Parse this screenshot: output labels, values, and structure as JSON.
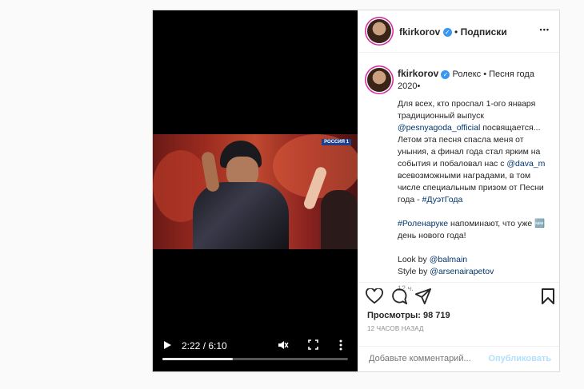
{
  "header": {
    "username": "fkirkorov",
    "separator": "•",
    "follow": "Подписки",
    "more": "•••"
  },
  "caption": {
    "username": "fkirkorov",
    "location": "Ролекс • Песня года 2020•",
    "text1": "Для всех, кто проспал 1-ого января традиционный выпуск",
    "mention1": "@pesnyagoda_official",
    "text2": "посвящается... Летом эта песня спасла меня от уныния, а финал года стал ярким на события и побаловал нас с",
    "mention2": "@dava_m",
    "text3": "всевозможными наградами, в том числе специальным призом от Песни года -",
    "hashtag1": "#ДуэтГода",
    "hashtag2": "#Роленаруке",
    "text4": "напоминают, что уже 🆕 день нового года!",
    "look_label": "Look by",
    "look_mention": "@balmain",
    "style_label": "Style by",
    "style_mention": "@arsenairapetov",
    "time": "12 ч."
  },
  "stats": {
    "views": "Просмотры: 98 719",
    "time_ago": "12 ЧАСОВ НАЗАД"
  },
  "comment": {
    "placeholder": "Добавьте комментарий...",
    "publish": "Опубликовать"
  },
  "video": {
    "channel_logo": "РОССИЯ 1",
    "time": "2:22 / 6:10",
    "progress": 0.38
  },
  "icons": {
    "like": "heart-icon",
    "comment": "comment-icon",
    "share": "share-icon",
    "save": "bookmark-icon",
    "play": "play-icon",
    "mute": "muted-icon",
    "fullscreen": "fullscreen-icon",
    "options": "vertical-dots-icon"
  },
  "colors": {
    "verified": "#3897f0",
    "link": "#00376b",
    "publish_disabled": "#b2dffc"
  }
}
